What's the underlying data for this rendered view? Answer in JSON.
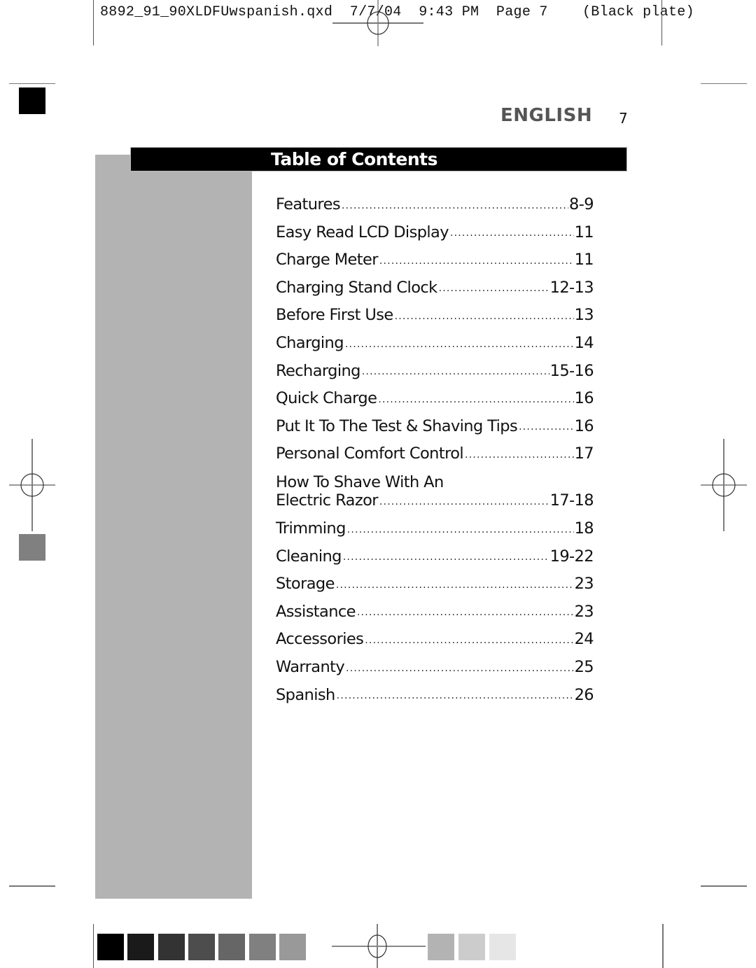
{
  "slug": {
    "filename": "8892_91_90XLDFUwspanish.qxd",
    "date": "7/7/04",
    "time": "9:43 PM",
    "page_label": "Page 7",
    "plate": "(Black plate)"
  },
  "header": {
    "language": "ENGLISH",
    "page_number": "7"
  },
  "toc": {
    "title": "Table of Contents",
    "items": [
      {
        "title": "Features",
        "page": "8-9"
      },
      {
        "title": "Easy Read LCD Display",
        "page": "11"
      },
      {
        "title": "Charge Meter",
        "page": "11"
      },
      {
        "title": "Charging Stand Clock",
        "page": "12-13"
      },
      {
        "title": "Before First Use",
        "page": "13"
      },
      {
        "title": "Charging",
        "page": "14"
      },
      {
        "title": "Recharging",
        "page": "15-16"
      },
      {
        "title": "Quick Charge",
        "page": "16"
      },
      {
        "title": "Put It To The Test & Shaving Tips",
        "page": "16"
      },
      {
        "title": "Personal Comfort Control",
        "page": "17"
      },
      {
        "title_line1": "How To Shave With An",
        "title": "Electric Razor",
        "page": "17-18"
      },
      {
        "title": "Trimming",
        "page": "18"
      },
      {
        "title": "Cleaning",
        "page": "19-22"
      },
      {
        "title": "Storage",
        "page": "23"
      },
      {
        "title": "Assistance",
        "page": "23"
      },
      {
        "title": "Accessories",
        "page": "24"
      },
      {
        "title": "Warranty",
        "page": "25"
      },
      {
        "title": "Spanish",
        "page": "26"
      }
    ]
  },
  "colors": {
    "grayscale_swatches_dark": [
      "#000000",
      "#1a1a1a",
      "#333333",
      "#4d4d4d",
      "#666666",
      "#808080",
      "#999999"
    ],
    "grayscale_swatches_light": [
      "#b3b3b3",
      "#cccccc",
      "#e6e6e6"
    ],
    "panel_gray": "#b3b3b3",
    "language_gray": "#555555"
  }
}
